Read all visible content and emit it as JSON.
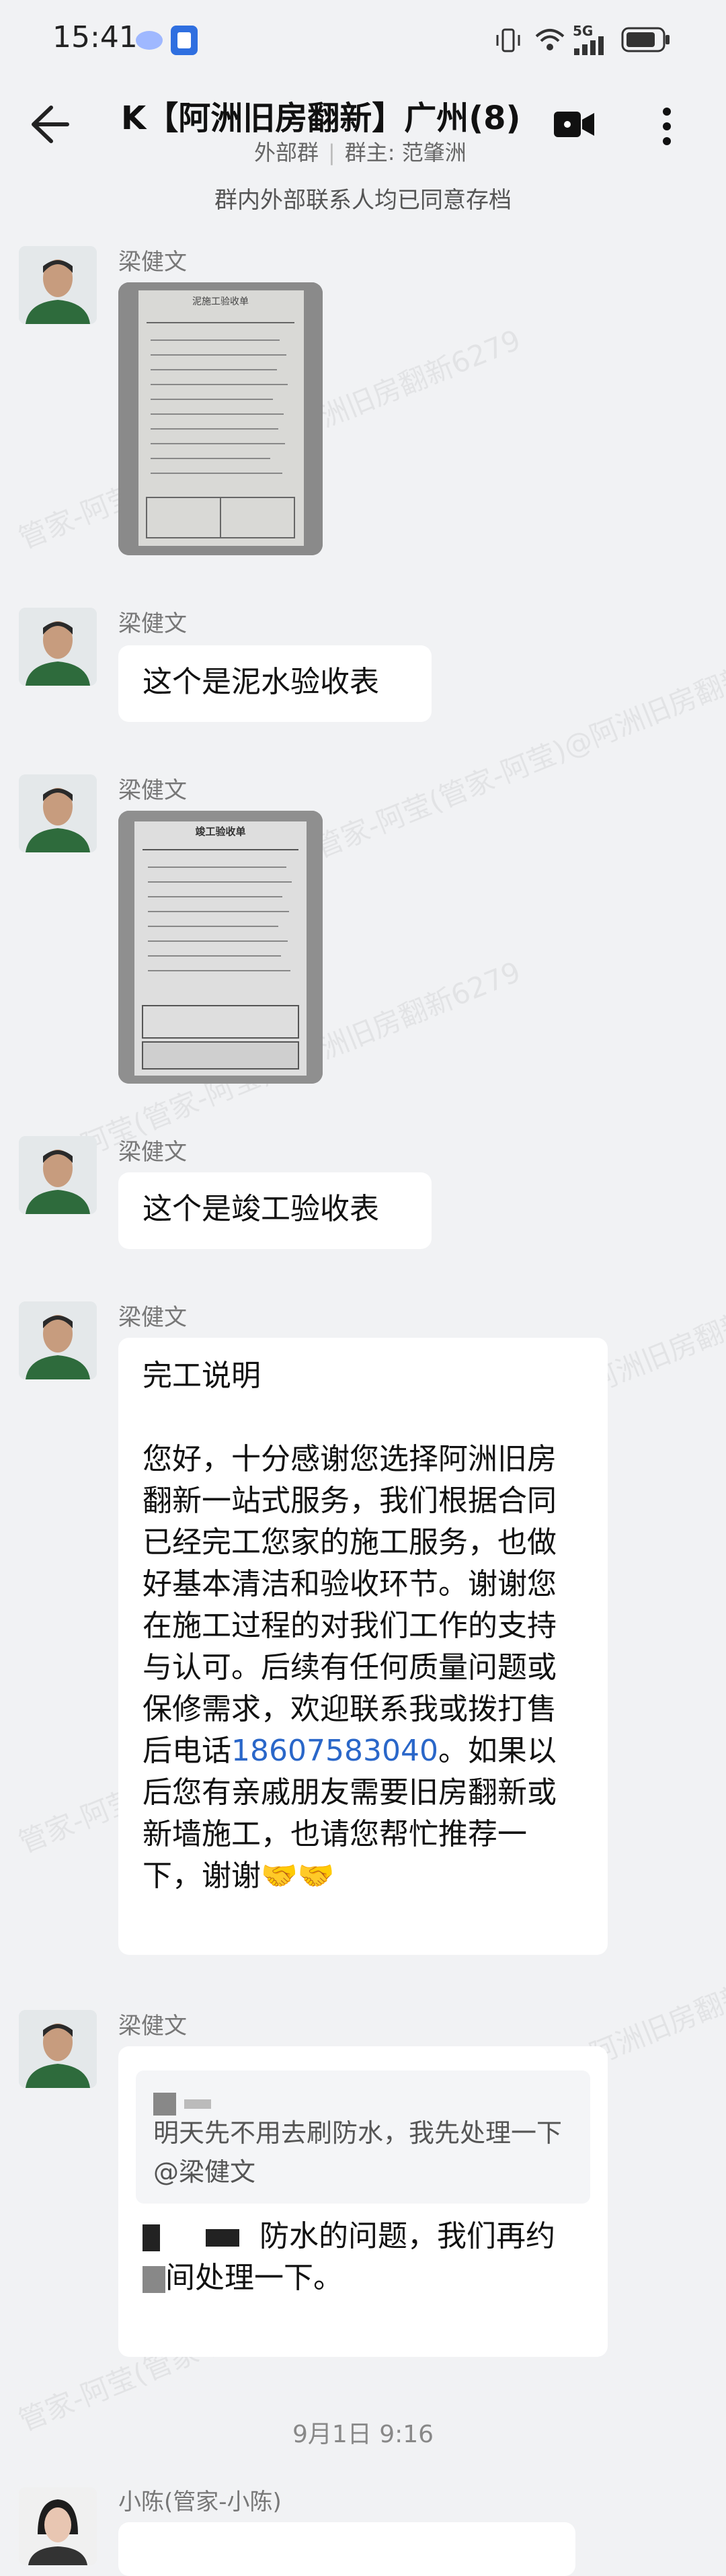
{
  "status_bar": {
    "time": "15:41",
    "network": "5G"
  },
  "header": {
    "title": "K【阿洲旧房翻新】广州(8)",
    "group_type": "外部群",
    "owner": "群主: 范肇洲"
  },
  "notice": "群内外部联系人均已同意存档",
  "watermark": "管家-阿莹(管家-阿莹)@阿洲旧房翻新6279",
  "messages": [
    {
      "sender": "梁健文"
    },
    {
      "sender": "梁健文",
      "text": "这个是泥水验收表"
    },
    {
      "sender": "梁健文"
    },
    {
      "sender": "梁健文",
      "text": "这个是竣工验收表"
    },
    {
      "sender": "梁健文",
      "title": "完工说明",
      "body_before_phone": "您好，十分感谢您选择阿洲旧房翻新一站式服务，我们根据合同已经完工您家的施工服务，也做好基本清洁和验收环节。谢谢您在施工过程的对我们工作的支持与认可。后续有任何质量问题或保修需求，欢迎联系我或拨打售后电话",
      "phone": "18607583040",
      "body_after_phone": "。如果以后您有亲戚朋友需要旧房翻新或新墙施工，也请您帮忙推荐一下，谢谢🤝🤝"
    },
    {
      "sender": "梁健文",
      "quote": "明天先不用去刷防水，我先处理一下 @梁健文",
      "reply_part1": "防水的问题，我们再约",
      "reply_part2": "间处理一下。"
    }
  ],
  "timestamp": "9月1日  9:16",
  "last_sender": "小陈(管家-小陈)",
  "photo_doc1": {
    "title": "泥施工验收单"
  },
  "photo_doc2": {
    "title": "竣工验收单"
  }
}
